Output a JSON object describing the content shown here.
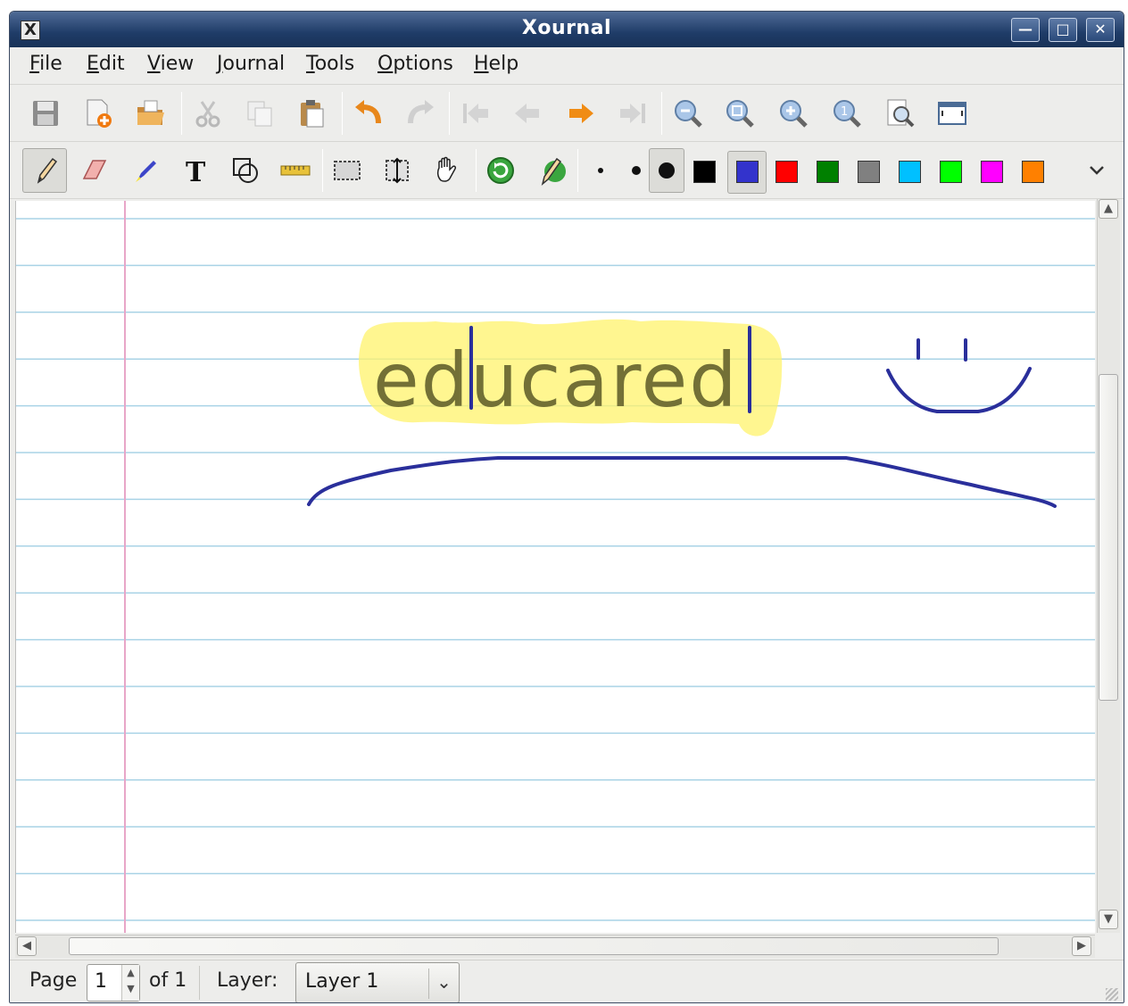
{
  "window": {
    "title": "Xournal"
  },
  "menu": {
    "items": [
      "File",
      "Edit",
      "View",
      "Journal",
      "Tools",
      "Options",
      "Help"
    ]
  },
  "toolbar_main": {
    "buttons": [
      "save-icon",
      "new-page-icon",
      "open-icon",
      "cut-icon",
      "copy-icon",
      "paste-icon",
      "undo-icon",
      "redo-icon",
      "first-page-icon",
      "previous-page-icon",
      "next-page-icon",
      "last-page-icon",
      "zoom-out-icon",
      "zoom-fit-icon",
      "zoom-in-icon",
      "zoom-100-icon",
      "zoom-page-width-icon",
      "fullscreen-icon"
    ]
  },
  "toolbar_tools": {
    "tools": [
      "pen-icon",
      "eraser-icon",
      "highlighter-icon",
      "text-icon",
      "shape-recognizer-icon",
      "ruler-icon",
      "select-rectangle-icon",
      "vertical-space-icon",
      "hand-icon",
      "default-tools-icon",
      "default-pen-icon"
    ],
    "selected_tool": "pen",
    "thickness": [
      "thin",
      "medium",
      "thick"
    ],
    "selected_thickness": "thick",
    "colors": [
      "#000000",
      "#3333cc",
      "#ff0000",
      "#008000",
      "#808080",
      "#00c0ff",
      "#00ff00",
      "#ff00ff",
      "#ff8000"
    ],
    "selected_color": "#3333cc"
  },
  "canvas": {
    "handwriting": "educared",
    "highlight_color": "#fff36b",
    "ink_color": "#2a2f9b",
    "rule_color": "#a9d3e6",
    "margin_color": "#e8a6c8"
  },
  "status": {
    "page_label": "Page",
    "page_value": "1",
    "page_total": "of 1",
    "layer_label": "Layer:",
    "layer_value": "Layer 1"
  }
}
